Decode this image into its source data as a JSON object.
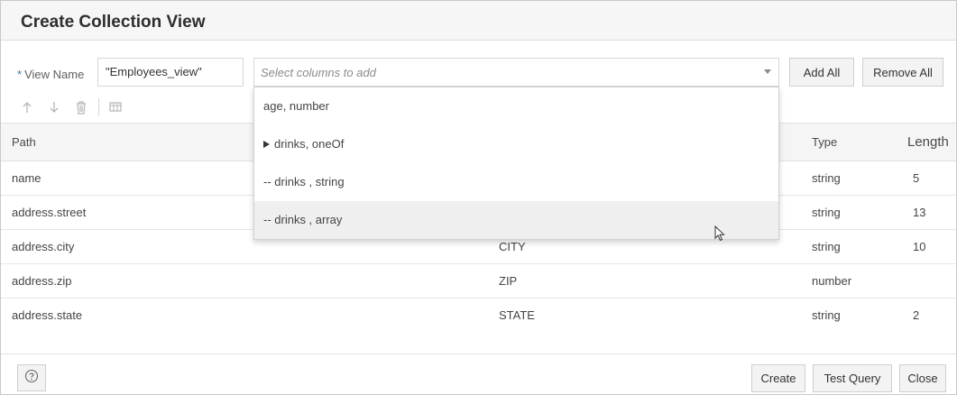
{
  "dialog": {
    "title": "Create Collection View"
  },
  "form": {
    "required_mark": "*",
    "view_name_label": "View Name",
    "view_name_value": "\"Employees_view\"",
    "columns_placeholder": "Select columns to add",
    "add_all_label": "Add All",
    "remove_all_label": "Remove All"
  },
  "toolbar": {
    "icons": [
      "arrow-up-icon",
      "arrow-down-icon",
      "trash-icon",
      "column-settings-icon"
    ]
  },
  "table": {
    "headers": {
      "path": "Path",
      "type": "Type",
      "length": "Length"
    },
    "rows": [
      {
        "path": "name",
        "column": "",
        "type": "string",
        "length": "5"
      },
      {
        "path": "address.street",
        "column": "",
        "type": "string",
        "length": "13"
      },
      {
        "path": "address.city",
        "column": "CITY",
        "type": "string",
        "length": "10"
      },
      {
        "path": "address.zip",
        "column": "ZIP",
        "type": "number",
        "length": ""
      },
      {
        "path": "address.state",
        "column": "STATE",
        "type": "string",
        "length": "2"
      }
    ]
  },
  "dropdown": {
    "items": [
      {
        "label": "age, number"
      },
      {
        "label": "drinks, oneOf",
        "expander": true
      },
      {
        "label": "-- drinks , string"
      },
      {
        "label": "-- drinks , array",
        "hovered": true
      }
    ]
  },
  "footer": {
    "help_icon": "help-icon",
    "create_label": "Create",
    "test_query_label": "Test Query",
    "close_label": "Close"
  }
}
